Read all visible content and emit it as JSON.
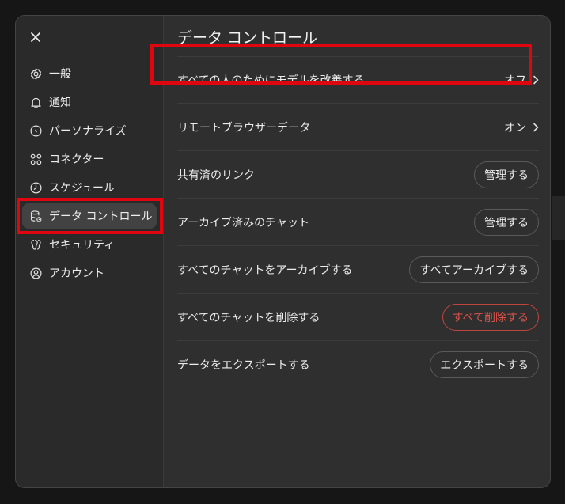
{
  "sidebar": {
    "items": [
      {
        "label": "一般",
        "icon": "gear-icon"
      },
      {
        "label": "通知",
        "icon": "bell-icon"
      },
      {
        "label": "パーソナライズ",
        "icon": "personalize-icon"
      },
      {
        "label": "コネクター",
        "icon": "connector-icon"
      },
      {
        "label": "スケジュール",
        "icon": "clock-icon"
      },
      {
        "label": "データ コントロール",
        "icon": "database-gear-icon",
        "active": true
      },
      {
        "label": "セキュリティ",
        "icon": "shield-icon"
      },
      {
        "label": "アカウント",
        "icon": "user-circle-icon"
      }
    ]
  },
  "main": {
    "title": "データ コントロール",
    "rows": [
      {
        "label": "すべての人のためにモデルを改善する",
        "value": "オフ"
      },
      {
        "label": "リモートブラウザーデータ",
        "value": "オン"
      },
      {
        "label": "共有済のリンク",
        "button": "管理する"
      },
      {
        "label": "アーカイブ済みのチャット",
        "button": "管理する"
      },
      {
        "label": "すべてのチャットをアーカイブする",
        "button": "すべてアーカイブする"
      },
      {
        "label": "すべてのチャットを削除する",
        "button": "すべて削除する"
      },
      {
        "label": "データをエクスポートする",
        "button": "エクスポートする"
      }
    ]
  },
  "colors": {
    "highlight": "#e0060f",
    "danger": "#d9534a",
    "dialog_bg": "#2f2f2f",
    "sidebar_bg": "#2a2a2a"
  }
}
